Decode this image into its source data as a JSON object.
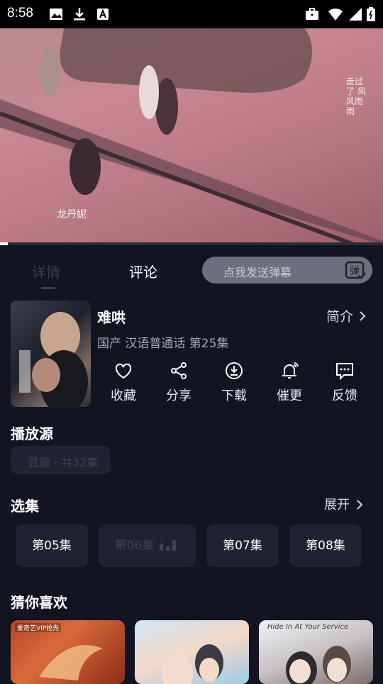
{
  "status_bar": {
    "time": "8:58"
  },
  "video": {
    "watermark_artist": "龙丹妮",
    "watermark_side": "走过了 风风雨雨",
    "progress": 0.02
  },
  "tabs": [
    {
      "label": "详情",
      "active": false
    },
    {
      "label": "评论",
      "active": true
    }
  ],
  "danmaku": {
    "placeholder": "点我发送弹幕",
    "icon_text": "弹"
  },
  "show": {
    "title": "难哄",
    "meta": "国产 汉语普通话 第25集",
    "intro_label": "简介"
  },
  "actions": [
    {
      "label": "收藏",
      "icon": "heart-icon"
    },
    {
      "label": "分享",
      "icon": "share-icon"
    },
    {
      "label": "下载",
      "icon": "download-icon"
    },
    {
      "label": "催更",
      "icon": "bell-icon"
    },
    {
      "label": "反馈",
      "icon": "feedback-icon"
    }
  ],
  "source": {
    "section_title": "播放源",
    "chip_label": "豆瓣 · 共32集"
  },
  "episodes": {
    "section_title": "选集",
    "expand_label": "展开",
    "items": [
      {
        "label": "第05集",
        "active": false
      },
      {
        "label": "第06集",
        "active": true
      },
      {
        "label": "第07集",
        "active": false
      },
      {
        "label": "第08集",
        "active": false
      }
    ]
  },
  "recommend": {
    "section_title": "猜你喜欢",
    "cards": [
      {
        "tag": "爱奇艺VIP抢先"
      },
      {
        "tag": ""
      },
      {
        "tag": "Hide In At Your Service"
      }
    ]
  },
  "colors": {
    "background": "#121422",
    "chip": "#1f2232",
    "muted": "#a3a6b8"
  }
}
